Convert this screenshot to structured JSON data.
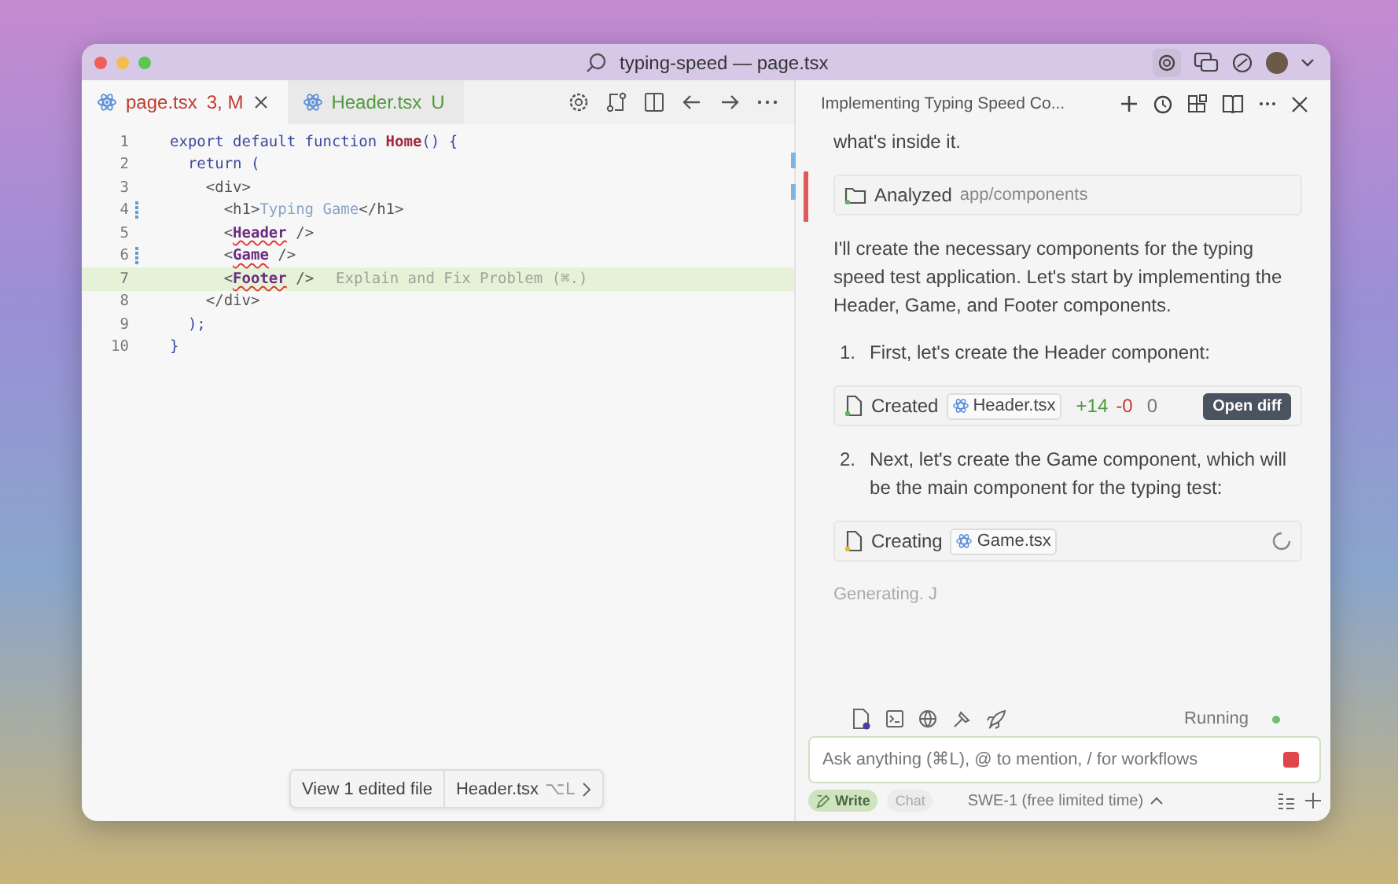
{
  "window": {
    "title": "typing-speed — page.tsx"
  },
  "tabs": [
    {
      "label": "page.tsx",
      "badge": "3, M",
      "kind": "modified",
      "selected": true
    },
    {
      "label": "Header.tsx",
      "badge": "U",
      "kind": "untracked",
      "selected": false
    }
  ],
  "editor": {
    "lines": [
      {
        "number": "1",
        "modified": false,
        "highlighted": false,
        "tokens": [
          {
            "kind": "keyword",
            "text": "export default function "
          },
          {
            "kind": "fn",
            "text": "Home"
          },
          {
            "kind": "keyword",
            "text": "() {"
          }
        ]
      },
      {
        "number": "2",
        "modified": false,
        "highlighted": false,
        "tokens": [
          {
            "kind": "keyword",
            "text": "  return ("
          }
        ]
      },
      {
        "number": "3",
        "modified": false,
        "highlighted": false,
        "tokens": [
          {
            "kind": "tag",
            "text": "    <div>"
          }
        ]
      },
      {
        "number": "4",
        "modified": true,
        "highlighted": false,
        "tokens": [
          {
            "kind": "tag",
            "text": "      <h1>"
          },
          {
            "kind": "text",
            "text": "Typing Game"
          },
          {
            "kind": "tag",
            "text": "</h1>"
          }
        ]
      },
      {
        "number": "5",
        "modified": false,
        "highlighted": false,
        "tokens": [
          {
            "kind": "tag",
            "text": "      <"
          },
          {
            "kind": "error",
            "text": "Header"
          },
          {
            "kind": "tag",
            "text": " />"
          }
        ]
      },
      {
        "number": "6",
        "modified": true,
        "highlighted": false,
        "tokens": [
          {
            "kind": "tag",
            "text": "      <"
          },
          {
            "kind": "error",
            "text": "Game"
          },
          {
            "kind": "tag",
            "text": " />"
          }
        ]
      },
      {
        "number": "7",
        "modified": false,
        "highlighted": true,
        "tokens": [
          {
            "kind": "tag",
            "text": "      <"
          },
          {
            "kind": "error",
            "text": "Footer"
          },
          {
            "kind": "tag",
            "text": " />"
          },
          {
            "kind": "hint",
            "text": "Explain and Fix Problem (⌘.)"
          }
        ]
      },
      {
        "number": "8",
        "modified": false,
        "highlighted": false,
        "tokens": [
          {
            "kind": "tag",
            "text": "    </div>"
          }
        ]
      },
      {
        "number": "9",
        "modified": false,
        "highlighted": false,
        "tokens": [
          {
            "kind": "keyword",
            "text": "  );"
          }
        ]
      },
      {
        "number": "10",
        "modified": false,
        "highlighted": false,
        "tokens": [
          {
            "kind": "keyword",
            "text": "}"
          }
        ]
      }
    ]
  },
  "edited_bar": {
    "summary": "View 1 edited file",
    "file": "Header.tsx",
    "shortcut": "⌥L"
  },
  "chat": {
    "title": "Implementing Typing Speed Co...",
    "items": [
      {
        "kind": "paragraph",
        "text": "what's inside it."
      },
      {
        "kind": "tool",
        "action": "Analyzed",
        "target": "app/components"
      },
      {
        "kind": "paragraph",
        "text": "I'll create the necessary components for the typing speed test application. Let's start by implementing the Header, Game, and Footer components."
      },
      {
        "kind": "step",
        "number": "1.",
        "text": "First, let's create the Header component:"
      },
      {
        "kind": "file",
        "action": "Created",
        "file": "Header.tsx",
        "added": "+14",
        "removed": "-0",
        "other": "0",
        "done": true,
        "button": "Open diff"
      },
      {
        "kind": "step",
        "number": "2.",
        "text": "Next, let's create the Game component, which will be the main component for the typing test:"
      },
      {
        "kind": "file",
        "action": "Creating",
        "file": "Game.tsx",
        "done": false
      },
      {
        "kind": "status",
        "text": "Generating. J"
      }
    ],
    "status": {
      "label": "Running",
      "color": "#6cc070"
    },
    "input": {
      "placeholder": "Ask anything (⌘L), @ to mention, / for workflows"
    },
    "modes": [
      {
        "label": "Write",
        "selected": true
      },
      {
        "label": "Chat",
        "selected": false
      }
    ],
    "model": "SWE-1 (free limited time)"
  }
}
